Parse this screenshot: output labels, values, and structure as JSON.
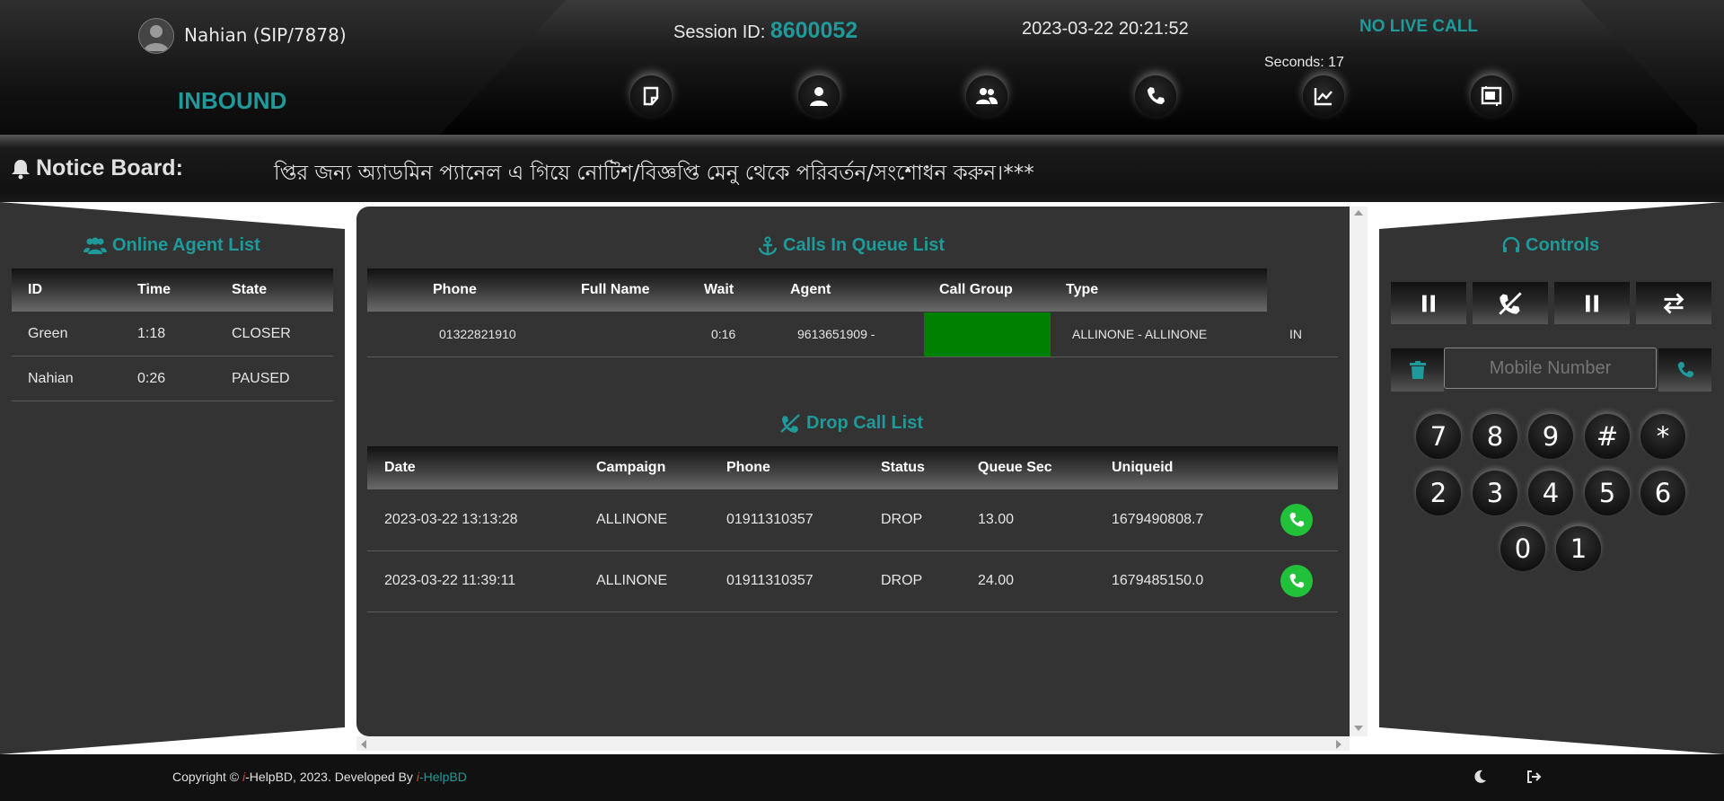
{
  "header": {
    "agent_name": "Nahian (SIP/7878)",
    "mode": "INBOUND",
    "session_label": "Session ID:",
    "session_id": "8600052",
    "datetime": "2023-03-22 20:21:52",
    "live_call_status": "NO LIVE CALL",
    "seconds_label": "Seconds: 17",
    "icons": [
      "notes-icon",
      "user-icon",
      "users-icon",
      "phone-icon",
      "chart-icon",
      "gallery-icon"
    ]
  },
  "notice": {
    "title": "Notice Board:",
    "text": "প্তির জন্য অ্যাডমিন প্যানেল এ গিয়ে নোটিশ/বিজ্ঞপ্তি মেনু থেকে পরিবর্তন/সংশোধন করুন।***"
  },
  "agents": {
    "title": "Online Agent List",
    "columns": [
      "ID",
      "Time",
      "State"
    ],
    "rows": [
      [
        "Green",
        "1:18",
        "CLOSER"
      ],
      [
        "Nahian",
        "0:26",
        "PAUSED"
      ]
    ]
  },
  "queue": {
    "title": "Calls In Queue List",
    "columns": [
      "Phone",
      "Full Name",
      "Wait",
      "Agent",
      "Call Group",
      "Type"
    ],
    "rows": [
      {
        "phone": "01322821910",
        "full_name": "",
        "wait": "0:16",
        "agent": "9613651909 -",
        "call_group": "",
        "group_color": "#008000",
        "type": "ALLINONE - ALLINONE",
        "extra": "IN"
      }
    ]
  },
  "drops": {
    "title": "Drop Call List",
    "columns": [
      "Date",
      "Campaign",
      "Phone",
      "Status",
      "Queue Sec",
      "Uniqueid"
    ],
    "rows": [
      [
        "2023-03-22 13:13:28",
        "ALLINONE",
        "01911310357",
        "DROP",
        "13.00",
        "1679490808.7"
      ],
      [
        "2023-03-22 11:39:11",
        "ALLINONE",
        "01911310357",
        "DROP",
        "24.00",
        "1679485150.0"
      ]
    ]
  },
  "controls": {
    "title": "Controls",
    "buttons": [
      "pause-icon",
      "hangup-icon",
      "hold-icon",
      "transfer-icon"
    ],
    "mobile_placeholder": "Mobile Number",
    "dialpad": [
      "7",
      "8",
      "9",
      "#",
      "*",
      "2",
      "3",
      "4",
      "5",
      "6",
      "0",
      "1"
    ]
  },
  "footer": {
    "copyright": "Copyright ©",
    "brand_i": "i",
    "brand_rest": "-HelpBD, 2023. Developed By",
    "dev_i": "i",
    "dev_rest": "-HelpBD"
  },
  "colors": {
    "accent": "#1f9a9a",
    "call_green": "#22c13a",
    "queue_group": "#008000"
  }
}
